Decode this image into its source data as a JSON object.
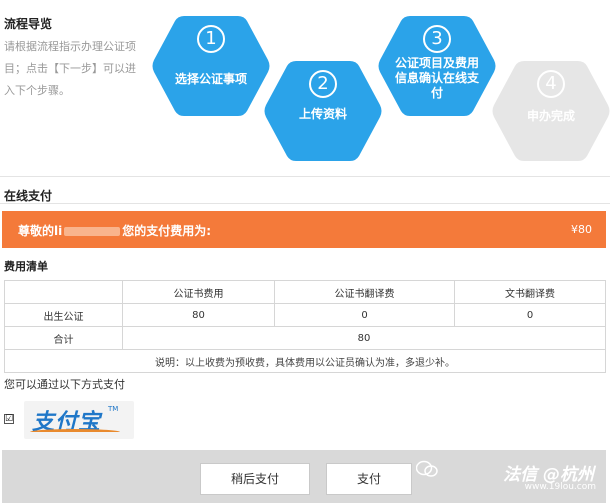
{
  "flow": {
    "title": "流程导览",
    "description": "请根据流程指示办理公证项目；点击【下一步】可以进入下个步骤。",
    "steps": [
      {
        "num": "1",
        "label": "选择公证事项",
        "state": "active"
      },
      {
        "num": "2",
        "label": "上传资料",
        "state": "active"
      },
      {
        "num": "3",
        "label": "公证项目及费用信息确认在线支付",
        "state": "active"
      },
      {
        "num": "4",
        "label": "申办完成",
        "state": "inactive"
      }
    ]
  },
  "payment": {
    "section_title": "在线支付",
    "message_prefix": "尊敬的li",
    "message_suffix": "您的支付费用为:",
    "amount": "¥80"
  },
  "fees": {
    "title": "费用清单",
    "headers": [
      "",
      "公证书费用",
      "公证书翻译费",
      "文书翻译费"
    ],
    "rows": [
      [
        "出生公证",
        "80",
        "0",
        "0"
      ]
    ],
    "total_label": "合计",
    "total_value": "80",
    "note": "说明：以上收费为预收费，具体费用以公证员确认为准，多退少补。"
  },
  "methods": {
    "label": "您可以通过以下方式支付",
    "checkbox": "☑",
    "alipay_logo": "支付宝",
    "alipay_tm": "TM"
  },
  "footer": {
    "later_label": "稍后支付",
    "pay_label": "支付",
    "watermark": "法信 @杭州",
    "watermark_sub": "www.19lou.com"
  },
  "colors": {
    "step_blue": "#2ba3e9",
    "step_gray": "#e6e6e6",
    "pay_bar": "#f47a3a"
  }
}
